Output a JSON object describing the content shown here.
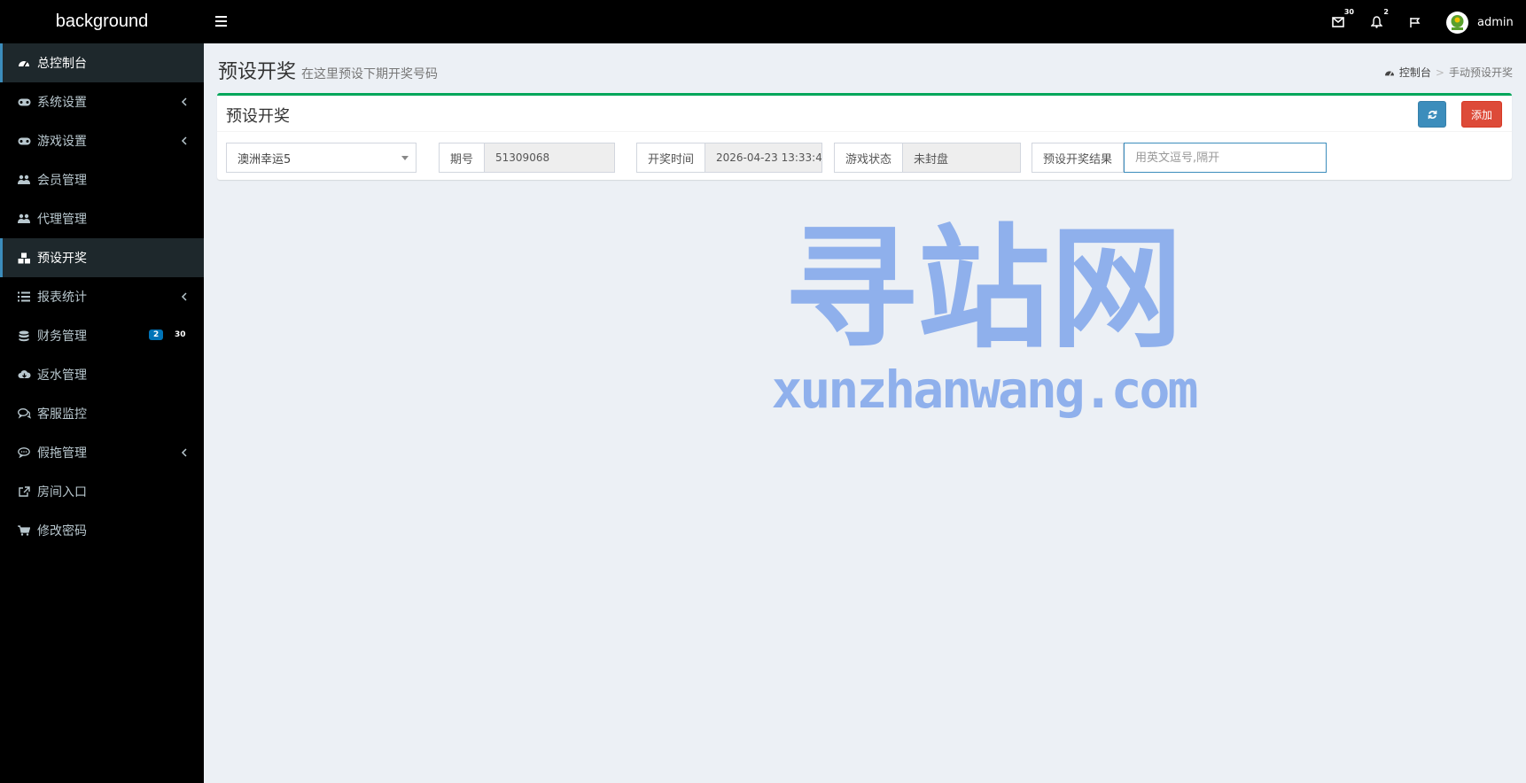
{
  "app": {
    "logo": "background"
  },
  "topbar": {
    "mail_badge": "30",
    "bell_badge": "2",
    "username": "admin",
    "icons": [
      "menu-toggle-icon",
      "mail-icon",
      "bell-icon",
      "flag-icon"
    ]
  },
  "sidebar": {
    "items": [
      {
        "label": "总控制台",
        "icon": "dashboard-icon",
        "active": true
      },
      {
        "label": "系统设置",
        "icon": "gamepad-icon",
        "has_children": true
      },
      {
        "label": "游戏设置",
        "icon": "gamepad-icon",
        "has_children": true
      },
      {
        "label": "会员管理",
        "icon": "users-icon"
      },
      {
        "label": "代理管理",
        "icon": "users-icon"
      },
      {
        "label": "预设开奖",
        "icon": "cubes-icon",
        "active": true
      },
      {
        "label": "报表统计",
        "icon": "list-icon",
        "has_children": true
      },
      {
        "label": "财务管理",
        "icon": "database-icon",
        "badges": [
          "2",
          "30"
        ]
      },
      {
        "label": "返水管理",
        "icon": "cloud-download-icon"
      },
      {
        "label": "客服监控",
        "icon": "comments-icon"
      },
      {
        "label": "假拖管理",
        "icon": "comment-icon",
        "has_children": true
      },
      {
        "label": "房间入口",
        "icon": "external-link-icon"
      },
      {
        "label": "修改密码",
        "icon": "cart-icon"
      }
    ],
    "badge_colors": {
      "blue": "#0073b7",
      "dark": "#000000"
    }
  },
  "page": {
    "title": "预设开奖",
    "subtitle": "在这里预设下期开奖号码",
    "breadcrumb": {
      "home": "控制台",
      "current": "手动预设开奖"
    }
  },
  "box": {
    "title": "预设开奖",
    "add_label": "添加",
    "game_select": "澳洲幸运5",
    "period_label": "期号",
    "period_value": "51309068",
    "draw_time_label": "开奖时间",
    "draw_time_value": "2026-04-23 13:33:4",
    "status_label": "游戏状态",
    "status_value": "未封盘",
    "result_label": "预设开奖结果",
    "result_placeholder": "用英文逗号,隔开"
  },
  "watermark": {
    "cn": "寻站网",
    "en": "xunzhanwang.com"
  },
  "colors": {
    "accent_green": "#00a65a",
    "primary": "#3c8dbc",
    "danger": "#dd4b39"
  }
}
